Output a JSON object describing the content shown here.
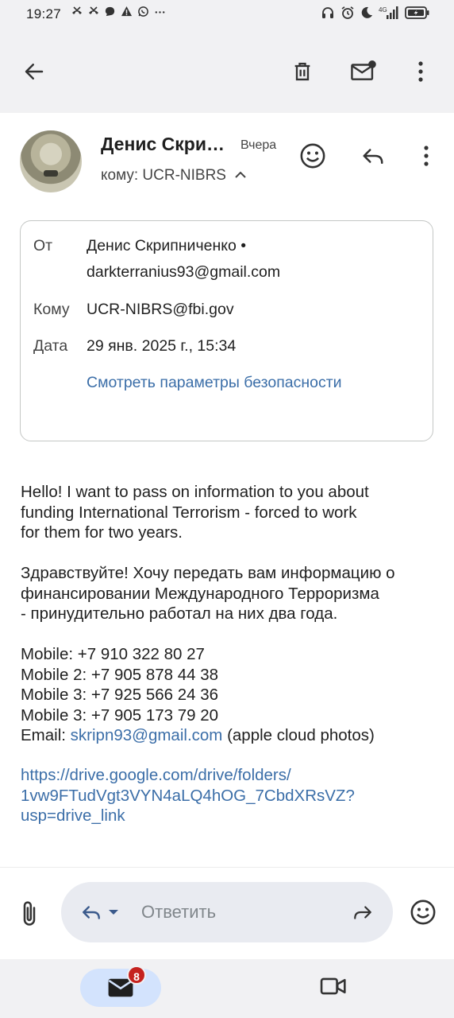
{
  "status_bar": {
    "time": "19:27",
    "notification_icons": [
      "missed-call-icon",
      "missed-call-icon",
      "message-icon",
      "alert-icon",
      "whatsapp-icon",
      "more-dots-icon"
    ],
    "system_icons": [
      "headphones-icon",
      "alarm-icon",
      "do-not-disturb-moon-icon",
      "signal-4g-icon",
      "battery-icon"
    ]
  },
  "app_bar": {
    "back_icon": "back-arrow-icon",
    "actions": [
      "delete-icon",
      "mark-unread-icon",
      "more-vert-icon"
    ]
  },
  "message_header": {
    "sender_name": "Денис Скри…",
    "date_short": "Вчера",
    "recipient_line": "кому: UCR-NIBRS",
    "actions": [
      "emoji-react-icon",
      "reply-icon",
      "more-vert-icon"
    ]
  },
  "details": {
    "from_label": "От",
    "from_name": "Денис Скрипниченко •",
    "from_email": "darkterranius93@gmail.com",
    "to_label": "Кому",
    "to_value": "UCR-NIBRS@fbi.gov",
    "date_label": "Дата",
    "date_value": "29 янв. 2025 г., 15:34",
    "security_link": "Смотреть параметры безопасности"
  },
  "body": {
    "en_line1": "Hello! I want to pass on information to you about",
    "en_line2": "funding International Terrorism - forced to work",
    "en_line3": "for them for two years.",
    "ru_line1": "Здравствуйте! Хочу передать вам информацию о",
    "ru_line2": "финансировании Международного Терроризма",
    "ru_line3": "- принудительно работал на них два года.",
    "mobile1": "Mobile: +7 910 322 80 27",
    "mobile2": "Mobile 2: +7 905 878 44 38",
    "mobile3": "Mobile 3: +7 925 566 24 36",
    "mobile4": "Mobile 3: +7 905 173 79 20",
    "email_label": "Email: ",
    "email_link": "skripn93@gmail.com",
    "email_note": " (apple cloud photos)",
    "url_line1": "https://drive.google.com/drive/folders/",
    "url_line2": "1vw9FTudVgt3VYN4aLQ4hOG_7CbdXRsVZ?",
    "url_line3": "usp=drive_link"
  },
  "composer": {
    "reply_placeholder": "Ответить"
  },
  "bottom_nav": {
    "mail_badge": "8"
  }
}
